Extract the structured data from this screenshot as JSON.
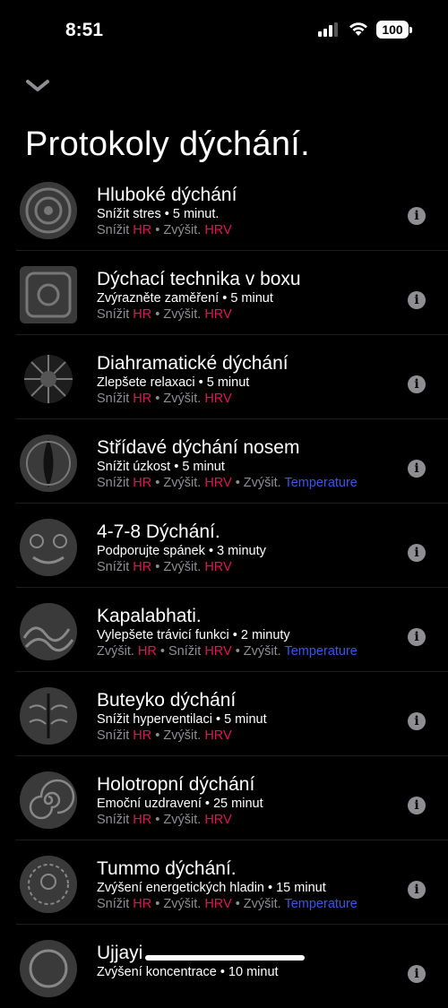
{
  "status": {
    "time": "8:51",
    "battery": "100"
  },
  "header": {
    "title": "Protokoly dýchání."
  },
  "items": [
    {
      "title": "Hluboké dýchání",
      "subtitle": "Snížit stres • 5 minut.",
      "tags": [
        {
          "t": "Snížit ",
          "c": "g"
        },
        {
          "t": "HR",
          "c": "r"
        },
        {
          "t": " • Zvýšit. ",
          "c": "g"
        },
        {
          "t": "HRV",
          "c": "r"
        }
      ]
    },
    {
      "title": "Dýchací technika v boxu",
      "subtitle": "Zvýrazněte zaměření • 5 minut",
      "tags": [
        {
          "t": "Snížit ",
          "c": "g"
        },
        {
          "t": "HR",
          "c": "r"
        },
        {
          "t": " • Zvýšit. ",
          "c": "g"
        },
        {
          "t": "HRV",
          "c": "r"
        }
      ]
    },
    {
      "title": "Diahramatické dýchání",
      "subtitle": "Zlepšete relaxaci • 5 minut",
      "tags": [
        {
          "t": "Snížit ",
          "c": "g"
        },
        {
          "t": "HR",
          "c": "r"
        },
        {
          "t": " • Zvýšit. ",
          "c": "g"
        },
        {
          "t": "HRV",
          "c": "r"
        }
      ]
    },
    {
      "title": "Střídavé dýchání nosem",
      "subtitle": "Snížit úzkost • 5 minut",
      "tags": [
        {
          "t": "Snížit ",
          "c": "g"
        },
        {
          "t": "HR",
          "c": "r"
        },
        {
          "t": " • Zvýšit. ",
          "c": "g"
        },
        {
          "t": "HRV",
          "c": "r"
        },
        {
          "t": " • Zvýšit. ",
          "c": "g"
        },
        {
          "t": "Temperature",
          "c": "b"
        }
      ]
    },
    {
      "title": "4-7-8 Dýchání.",
      "subtitle": "Podporujte spánek • 3 minuty",
      "tags": [
        {
          "t": "Snížit ",
          "c": "g"
        },
        {
          "t": "HR",
          "c": "r"
        },
        {
          "t": " • Zvýšit. ",
          "c": "g"
        },
        {
          "t": "HRV",
          "c": "r"
        }
      ]
    },
    {
      "title": "Kapalabhati.",
      "subtitle": "Vylepšete trávicí funkci • 2 minuty",
      "tags": [
        {
          "t": "Zvýšit. ",
          "c": "g"
        },
        {
          "t": "HR",
          "c": "r"
        },
        {
          "t": " • Snížit ",
          "c": "g"
        },
        {
          "t": "HRV",
          "c": "r"
        },
        {
          "t": " • Zvýšit. ",
          "c": "g"
        },
        {
          "t": "Temperature",
          "c": "b"
        }
      ]
    },
    {
      "title": "Buteyko dýchání",
      "subtitle": "Snížit hyperventilaci • 5 minut",
      "tags": [
        {
          "t": "Snížit ",
          "c": "g"
        },
        {
          "t": "HR",
          "c": "r"
        },
        {
          "t": " • Zvýšit. ",
          "c": "g"
        },
        {
          "t": "HRV",
          "c": "r"
        }
      ]
    },
    {
      "title": "Holotropní dýchání",
      "subtitle": "Emoční uzdravení • 25 minut",
      "tags": [
        {
          "t": "Snížit ",
          "c": "g"
        },
        {
          "t": "HR",
          "c": "r"
        },
        {
          "t": " • Zvýšit. ",
          "c": "g"
        },
        {
          "t": "HRV",
          "c": "r"
        }
      ]
    },
    {
      "title": "Tummo dýchání.",
      "subtitle": "Zvýšení energetických hladin • 15 minut",
      "tags": [
        {
          "t": "Snížit ",
          "c": "g"
        },
        {
          "t": "HR",
          "c": "r"
        },
        {
          "t": " • Zvýšit. ",
          "c": "g"
        },
        {
          "t": "HRV",
          "c": "r"
        },
        {
          "t": " • Zvýšit. ",
          "c": "g"
        },
        {
          "t": "Temperature",
          "c": "b"
        }
      ]
    },
    {
      "title": "Ujjayi",
      "subtitle": "Zvýšení koncentrace • 10 minut",
      "tags": []
    }
  ]
}
